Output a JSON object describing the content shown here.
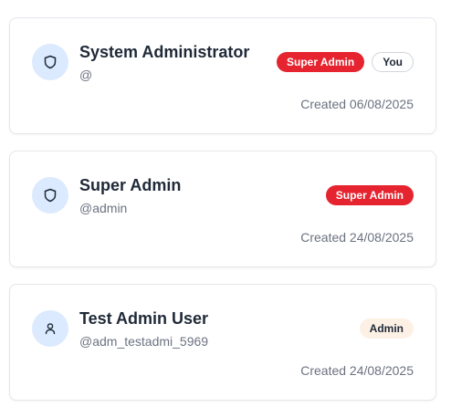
{
  "users": [
    {
      "name": "System Administrator",
      "handle": "@",
      "icon": "shield-icon",
      "role_badge": "Super Admin",
      "you_badge": "You",
      "created": "Created 06/08/2025"
    },
    {
      "name": "Super Admin",
      "handle": "@admin",
      "icon": "shield-icon",
      "role_badge": "Super Admin",
      "created": "Created 24/08/2025"
    },
    {
      "name": "Test Admin User",
      "handle": "@adm_testadmi_5969",
      "icon": "user-icon",
      "role_badge": "Admin",
      "created": "Created 24/08/2025"
    }
  ],
  "colors": {
    "avatar_bg": "#dbeafe",
    "super_admin_badge": "#e5242f",
    "admin_badge": "#fdf1e6",
    "card_border": "#e5e7eb"
  }
}
